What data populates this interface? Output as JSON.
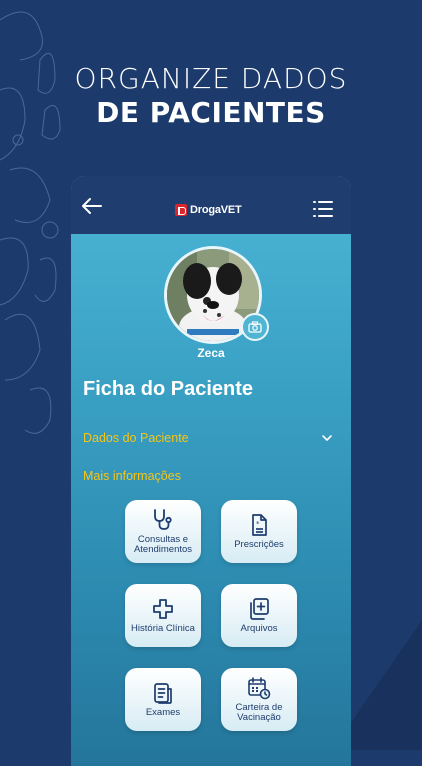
{
  "headline": {
    "line1": "ORGANIZE DADOS",
    "line2": "DE PACIENTES"
  },
  "appbar": {
    "logo_text": "DrogaVET",
    "back_icon": "arrow-left-icon",
    "menu_icon": "list-menu-icon"
  },
  "patient": {
    "name": "Zeca",
    "camera_icon": "camera-icon"
  },
  "page_title": "Ficha do Paciente",
  "section": {
    "label": "Dados do Paciente",
    "chevron_icon": "chevron-down-icon"
  },
  "more_info_label": "Mais informações",
  "tiles": [
    {
      "label": "Consultas e Atendimentos",
      "icon": "stethoscope-icon"
    },
    {
      "label": "Prescrições",
      "icon": "prescription-icon"
    },
    {
      "label": "História Clínica",
      "icon": "medical-cross-icon"
    },
    {
      "label": "Arquivos",
      "icon": "add-files-icon"
    },
    {
      "label": "Exames",
      "icon": "exam-document-icon"
    },
    {
      "label": "Carteira de Vacinação",
      "icon": "calendar-clock-icon"
    }
  ],
  "colors": {
    "background": "#1c3b6c",
    "appbar": "#1f3d6e",
    "accent": "#f5c518",
    "tile_text": "#1f3d6e"
  }
}
